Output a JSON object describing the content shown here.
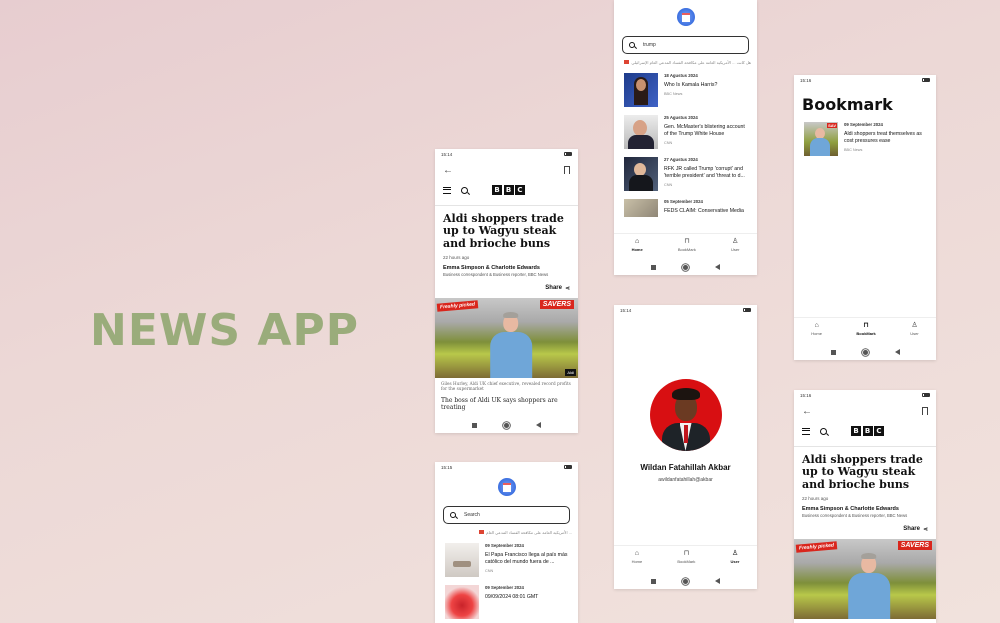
{
  "title": "NEWS APP",
  "colors": {
    "title": "#9aac7b",
    "accent_red": "#d9261c",
    "logo_blue": "#3b6fe0"
  },
  "status_bar": {
    "time_a": "15:14",
    "time_b": "15:15",
    "time_c": "15:16",
    "icons": "⚡ X ₱ ◂ ₱"
  },
  "article": {
    "logo_letters": [
      "B",
      "B",
      "C"
    ],
    "headline": "Aldi shoppers trade up to Wagyu steak and brioche buns",
    "ago": "22 hours ago",
    "authors": "Emma Simpson & Charlotte Edwards",
    "role": "Business correspondent & Business reporter, BBC News",
    "share": "Share",
    "photo_sign": "SAVERS",
    "photo_fresh": "Freshly picked",
    "photo_tag": "Aldi",
    "caption": "Giles Hurley, Aldi UK chief executive, revealed record profits for the supermarket",
    "lead": "The boss of Aldi UK says shoppers are treating"
  },
  "search1": {
    "value": "trump",
    "ticker": "هل كانت ... الأمريكية العامة على مكافحة الفساد المدعي العام الإسرائيلي",
    "items": [
      {
        "date": "18 Agustus 2024",
        "title": "Who Is Kamala Harris?",
        "source": "BBC News"
      },
      {
        "date": "25 Agustus 2024",
        "title": "Gen. McMaster's blistering account of the Trump White House",
        "source": "CNN"
      },
      {
        "date": "27 Agustus 2024",
        "title": "RFK JR called Trump 'corrupt' and 'terrible president' and 'threat to d...",
        "source": "CNN"
      },
      {
        "date": "05 September 2024",
        "title": "FEDS CLAIM: Conservative Media",
        "source": ""
      }
    ]
  },
  "search2": {
    "placeholder": "Search",
    "ticker": "... الأمريكية العامة على مكافحة الفساد المدعي العام",
    "items": [
      {
        "date": "09 September 2024",
        "title": "El Papa Francisco llega al país más católico del mundo fuera de ...",
        "source": "CNN"
      },
      {
        "date": "09 September 2024",
        "title": "09/09/2024 08:01 GMT",
        "source": ""
      }
    ]
  },
  "bookmark": {
    "heading": "Bookmark",
    "items": [
      {
        "date": "09 September 2024",
        "title": "Aldi shoppers treat themselves as cost pressures ease",
        "source": "BBC News"
      }
    ]
  },
  "user": {
    "name": "Wildan Fatahillah Akbar",
    "email": "awildanfatahillah@akbar"
  },
  "tabs": {
    "home": "Home",
    "bookmark": "BookMark",
    "user": "User"
  }
}
